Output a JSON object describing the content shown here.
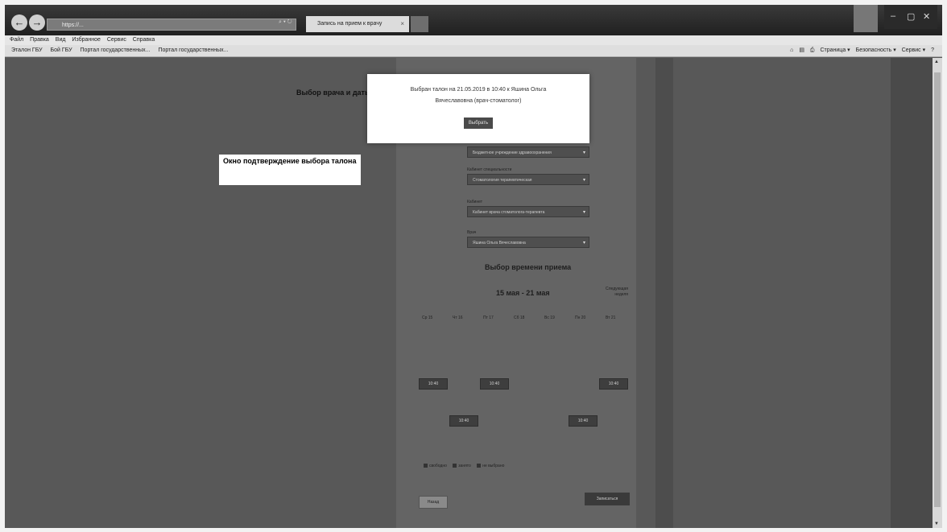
{
  "browser": {
    "address": "https://...",
    "tab_title": "Запись на прием к врачу",
    "tab_close": "×",
    "back_glyph": "←",
    "forward_glyph": "→",
    "win_min": "–",
    "win_max": "▢",
    "win_close": "✕"
  },
  "menu": [
    "Файл",
    "Правка",
    "Вид",
    "Избранное",
    "Сервис",
    "Справка"
  ],
  "favorites": [
    "Эталон ГБУ",
    "Бой ГБУ",
    "Портал государственных...",
    "Портал государственных..."
  ],
  "commandbar": [
    "Страница ▾",
    "Безопасность ▾",
    "Сервис ▾"
  ],
  "page": {
    "step_title": "Выбор врача и даты",
    "selects": [
      {
        "label": "",
        "value": "Бюджетное учреждение здравоохранения"
      },
      {
        "label": "Кабинет специальности",
        "value": "Стоматология терапевтическая"
      },
      {
        "label": "Кабинет",
        "value": "Кабинет врача стоматолога-терапевта"
      },
      {
        "label": "Врач",
        "value": "Яшина Ольга Вячеславовна"
      }
    ],
    "section_heading": "Выбор времени приема",
    "week_range": "15 мая - 21 мая",
    "week_next": "Следующая неделя",
    "days": [
      "Ср 15",
      "Чт 16",
      "Пт 17",
      "Сб 18",
      "Вс 19",
      "Пн 20",
      "Вт 21"
    ],
    "slots": [
      "10:40",
      "10:40",
      "10:40",
      "10:40",
      "10:40"
    ],
    "legend": [
      "свободно",
      "занято",
      "не выбрано"
    ],
    "back_label": "Назад",
    "next_label": "Записаться"
  },
  "callout": {
    "text": "Окно подтверждение выбора талона"
  },
  "modal": {
    "line1": "Выбран талон на 21.05.2019 в 10:40 к Яшина Ольга",
    "line2": "Вячеславовна (врач-стоматолог)",
    "button_label": "Выбрать"
  }
}
